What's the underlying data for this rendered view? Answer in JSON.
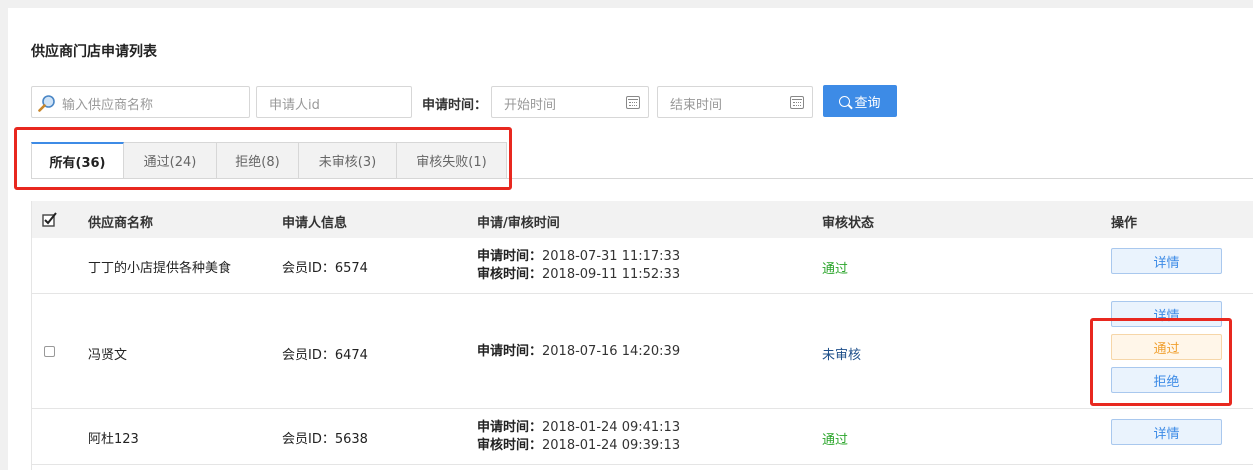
{
  "page_title": "供应商门店申请列表",
  "filters": {
    "supplier_placeholder": "输入供应商名称",
    "applicant_placeholder": "申请人id",
    "time_label": "申请时间：",
    "start_placeholder": "开始时间",
    "end_placeholder": "结束时间",
    "query_label": "查询"
  },
  "tabs": [
    {
      "label": "所有(36)",
      "active": true
    },
    {
      "label": "通过(24)",
      "active": false
    },
    {
      "label": "拒绝(8)",
      "active": false
    },
    {
      "label": "未审核(3)",
      "active": false
    },
    {
      "label": "审核失败(1)",
      "active": false
    }
  ],
  "table": {
    "headers": [
      "供应商名称",
      "申请人信息",
      "申请/审核时间",
      "审核状态",
      "操作"
    ],
    "rows": [
      {
        "supplier": "丁丁的小店提供各种美食",
        "applicant": "会员ID：6574",
        "apply_label": "申请时间：",
        "apply_time": "2018-07-31 11:17:33",
        "review_label": "审核时间：",
        "review_time": "2018-09-11 11:52:33",
        "status": "通过",
        "actions": [
          "详情"
        ]
      },
      {
        "supplier": "冯贤文",
        "applicant": "会员ID：6474",
        "apply_label": "申请时间：",
        "apply_time": "2018-07-16 14:20:39",
        "status": "未审核",
        "actions": [
          "详情",
          "通过",
          "拒绝"
        ]
      },
      {
        "supplier": "阿杜123",
        "applicant": "会员ID：5638",
        "apply_label": "申请时间：",
        "apply_time": "2018-01-24 09:41:13",
        "review_label": "审核时间：",
        "review_time": "2018-01-24 09:39:13",
        "status": "通过",
        "actions": [
          "详情"
        ]
      }
    ]
  },
  "colors": {
    "accent": "#3d8be6",
    "highlight_box": "#e8281f",
    "status_pass": "#2aa52a",
    "status_pending": "#1e4f8a",
    "action_pass": "#f0a030"
  }
}
